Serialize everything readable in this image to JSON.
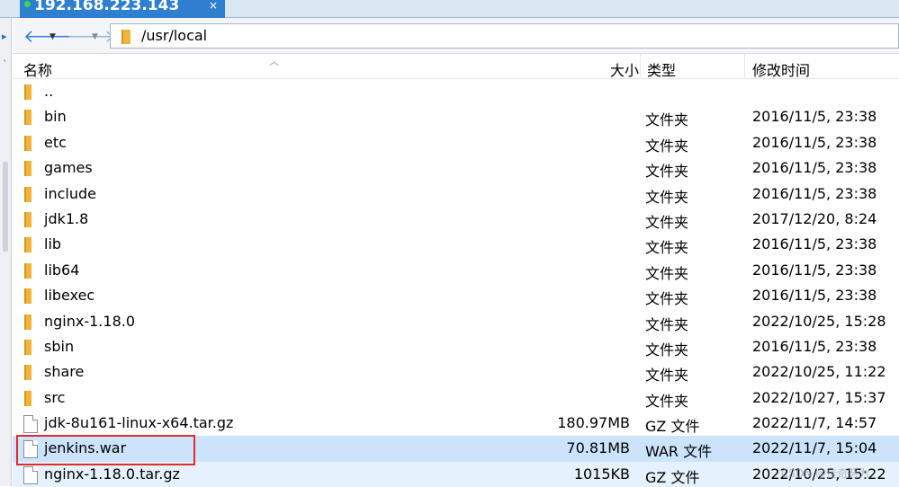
{
  "tab": {
    "title": "192.168.223.143",
    "close": "×"
  },
  "nav": {
    "back": "🡐",
    "back_dd": "▼",
    "forward": "🡒",
    "forward_dd": "▼"
  },
  "address": {
    "path": "/usr/local"
  },
  "gutter": {
    "mark1": "▸",
    "mark2": "`"
  },
  "columns": {
    "name": "名称",
    "size": "大小",
    "type": "类型",
    "modified": "修改时间",
    "sort_caret": "︿"
  },
  "files": [
    {
      "name": "..",
      "size": "",
      "type": "",
      "modified": "",
      "icon": "folder"
    },
    {
      "name": "bin",
      "size": "",
      "type": "文件夹",
      "modified": "2016/11/5, 23:38",
      "icon": "folder"
    },
    {
      "name": "etc",
      "size": "",
      "type": "文件夹",
      "modified": "2016/11/5, 23:38",
      "icon": "folder"
    },
    {
      "name": "games",
      "size": "",
      "type": "文件夹",
      "modified": "2016/11/5, 23:38",
      "icon": "folder"
    },
    {
      "name": "include",
      "size": "",
      "type": "文件夹",
      "modified": "2016/11/5, 23:38",
      "icon": "folder"
    },
    {
      "name": "jdk1.8",
      "size": "",
      "type": "文件夹",
      "modified": "2017/12/20, 8:24",
      "icon": "folder"
    },
    {
      "name": "lib",
      "size": "",
      "type": "文件夹",
      "modified": "2016/11/5, 23:38",
      "icon": "folder"
    },
    {
      "name": "lib64",
      "size": "",
      "type": "文件夹",
      "modified": "2016/11/5, 23:38",
      "icon": "folder"
    },
    {
      "name": "libexec",
      "size": "",
      "type": "文件夹",
      "modified": "2016/11/5, 23:38",
      "icon": "folder"
    },
    {
      "name": "nginx-1.18.0",
      "size": "",
      "type": "文件夹",
      "modified": "2022/10/25, 15:28",
      "icon": "folder"
    },
    {
      "name": "sbin",
      "size": "",
      "type": "文件夹",
      "modified": "2016/11/5, 23:38",
      "icon": "folder"
    },
    {
      "name": "share",
      "size": "",
      "type": "文件夹",
      "modified": "2022/10/25, 11:22",
      "icon": "folder"
    },
    {
      "name": "src",
      "size": "",
      "type": "文件夹",
      "modified": "2022/10/27, 15:37",
      "icon": "folder"
    },
    {
      "name": "jdk-8u161-linux-x64.tar.gz",
      "size": "180.97MB",
      "type": "GZ 文件",
      "modified": "2022/11/7, 14:57",
      "icon": "file"
    },
    {
      "name": "jenkins.war",
      "size": "70.81MB",
      "type": "WAR 文件",
      "modified": "2022/11/7, 15:04",
      "icon": "file"
    },
    {
      "name": "nginx-1.18.0.tar.gz",
      "size": "1015KB",
      "type": "GZ 文件",
      "modified": "2022/10/25, 15:22",
      "icon": "file"
    }
  ],
  "watermark": "CSDN @佳奇努力",
  "colors": {
    "tab": "#2e7fd0",
    "folder": "#f1b43b",
    "selected": "#cce4fb",
    "highlight_box": "#e52a2a"
  }
}
